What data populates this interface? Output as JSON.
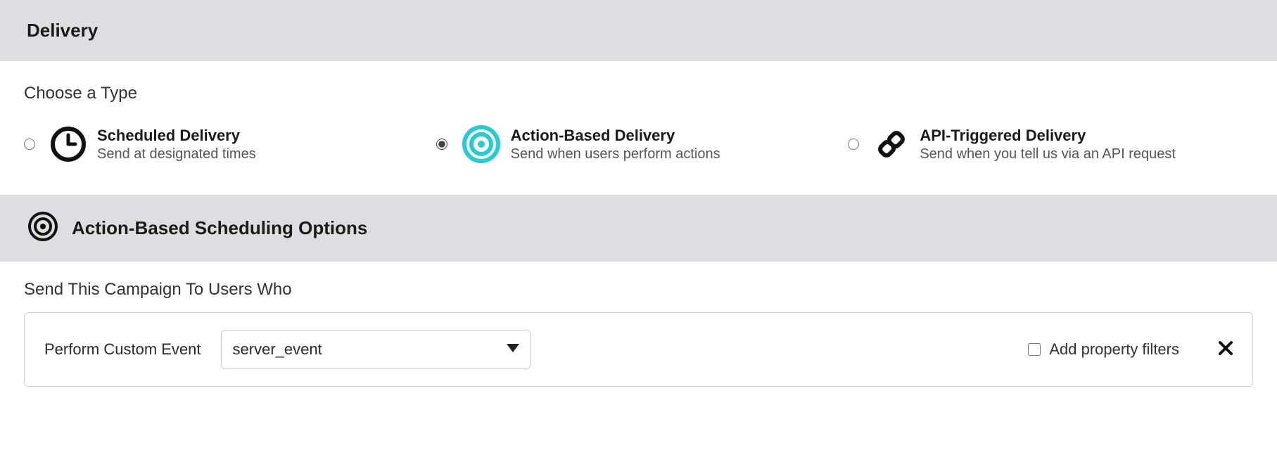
{
  "header": {
    "title": "Delivery"
  },
  "types": {
    "prompt": "Choose a Type",
    "options": [
      {
        "key": "scheduled",
        "title": "Scheduled Delivery",
        "desc": "Send at designated times",
        "selected": false
      },
      {
        "key": "action",
        "title": "Action-Based Delivery",
        "desc": "Send when users perform actions",
        "selected": true
      },
      {
        "key": "api",
        "title": "API-Triggered Delivery",
        "desc": "Send when you tell us via an API request",
        "selected": false
      }
    ]
  },
  "scheduling": {
    "title": "Action-Based Scheduling Options",
    "trigger_label": "Send This Campaign To Users Who",
    "condition_label": "Perform Custom Event",
    "event_value": "server_event",
    "filters_label": "Add property filters",
    "filters_checked": false
  }
}
